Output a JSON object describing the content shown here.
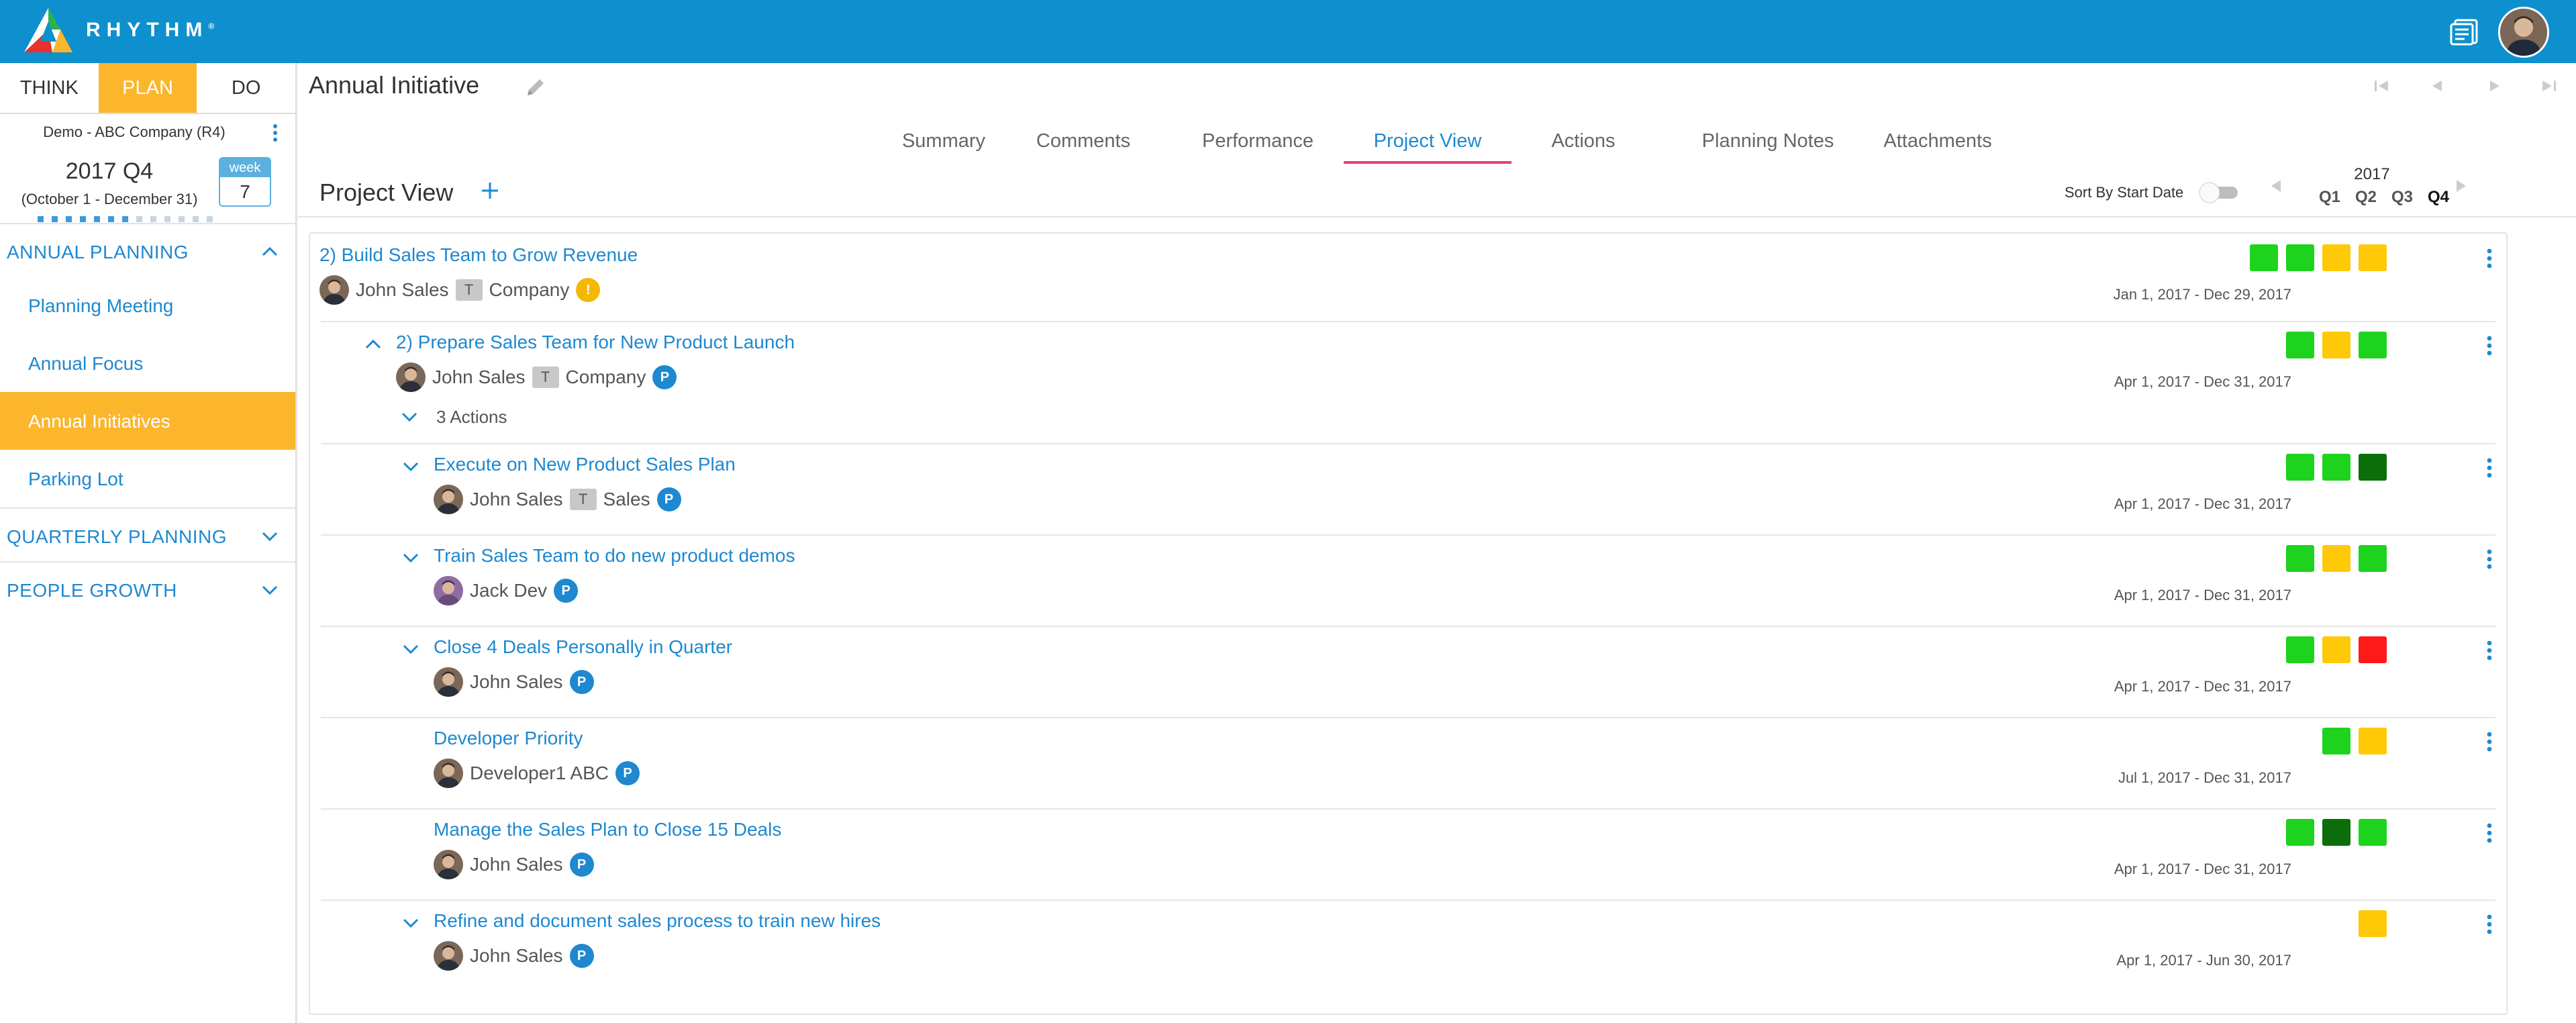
{
  "app": {
    "brand": "RHYTHM",
    "brand_mark": "®"
  },
  "modes": [
    {
      "label": "THINK",
      "active": false
    },
    {
      "label": "PLAN",
      "active": true
    },
    {
      "label": "DO",
      "active": false
    }
  ],
  "company": "Demo - ABC Company (R4)",
  "quarter": {
    "title": "2017 Q4",
    "range": "(October 1 - December 31)",
    "week_label": "week",
    "week_num": "7",
    "progress_weeks_on": 7,
    "progress_weeks_total": 13
  },
  "nav": {
    "annual_planning": "ANNUAL PLANNING",
    "items": [
      "Planning Meeting",
      "Annual Focus",
      "Annual Initiatives",
      "Parking Lot"
    ],
    "active_item": "Annual Initiatives",
    "quarterly_planning": "QUARTERLY PLANNING",
    "people_growth": "PEOPLE GROWTH"
  },
  "page": {
    "title": "Annual Initiative"
  },
  "tabs": [
    "Summary",
    "Comments",
    "Performance",
    "Project View",
    "Actions",
    "Planning Notes",
    "Attachments"
  ],
  "active_tab": "Project View",
  "project_view": {
    "title": "Project View",
    "sort_label": "Sort By Start Date",
    "sort_enabled": false,
    "year": "2017",
    "quarters": [
      "Q1",
      "Q2",
      "Q3",
      "Q4"
    ],
    "current_quarter": "Q4"
  },
  "colors": {
    "green": "#1ed31e",
    "yellow": "#ffc908",
    "dark_green": "#0b6e0b",
    "red": "#ff1a1a",
    "accent": "#1e88d0",
    "orange": "#fbb62c"
  },
  "rows": [
    {
      "title": "2) Build Sales Team to Grow Revenue",
      "owner": "John Sales",
      "type_badge": "T",
      "team": "Company",
      "status_badge": "!",
      "status_badge_color": "#f5b800",
      "dates": "Jan 1, 2017 - Dec 29, 2017",
      "squares": [
        "green",
        "green",
        "yellow",
        "yellow"
      ]
    },
    {
      "title": "2) Prepare Sales Team for New Product Launch",
      "owner": "John Sales",
      "type_badge": "T",
      "team": "Company",
      "status_badge": "P",
      "status_badge_color": "#1e88d0",
      "dates": "Apr 1, 2017 - Dec 31, 2017",
      "squares": [
        "green",
        "yellow",
        "green"
      ],
      "actions_count": "3 Actions"
    },
    {
      "title": "Execute on New Product Sales Plan",
      "owner": "John Sales",
      "type_badge": "T",
      "team": "Sales",
      "status_badge": "P",
      "status_badge_color": "#1e88d0",
      "dates": "Apr 1, 2017 - Dec 31, 2017",
      "squares": [
        "green",
        "green",
        "dark_green"
      ]
    },
    {
      "title": "Train Sales Team to do new product demos",
      "owner": "Jack Dev",
      "status_badge": "P",
      "status_badge_color": "#1e88d0",
      "dates": "Apr 1, 2017 - Dec 31, 2017",
      "squares": [
        "green",
        "yellow",
        "green"
      ]
    },
    {
      "title": "Close 4 Deals Personally in Quarter",
      "owner": "John Sales",
      "status_badge": "P",
      "status_badge_color": "#1e88d0",
      "dates": "Apr 1, 2017 - Dec 31, 2017",
      "squares": [
        "green",
        "yellow",
        "red"
      ]
    },
    {
      "title": "Developer Priority",
      "owner": "Developer1 ABC",
      "status_badge": "P",
      "status_badge_color": "#1e88d0",
      "dates": "Jul 1, 2017 - Dec 31, 2017",
      "squares": [
        "green",
        "yellow"
      ]
    },
    {
      "title": "Manage the Sales Plan to Close 15 Deals",
      "owner": "John Sales",
      "status_badge": "P",
      "status_badge_color": "#1e88d0",
      "dates": "Apr 1, 2017 - Dec 31, 2017",
      "squares": [
        "green",
        "dark_green",
        "green"
      ]
    },
    {
      "title": "Refine and document sales process to train new hires",
      "owner": "John Sales",
      "status_badge": "P",
      "status_badge_color": "#1e88d0",
      "dates": "Apr 1, 2017 - Jun 30, 2017",
      "squares": [
        "yellow"
      ]
    }
  ]
}
